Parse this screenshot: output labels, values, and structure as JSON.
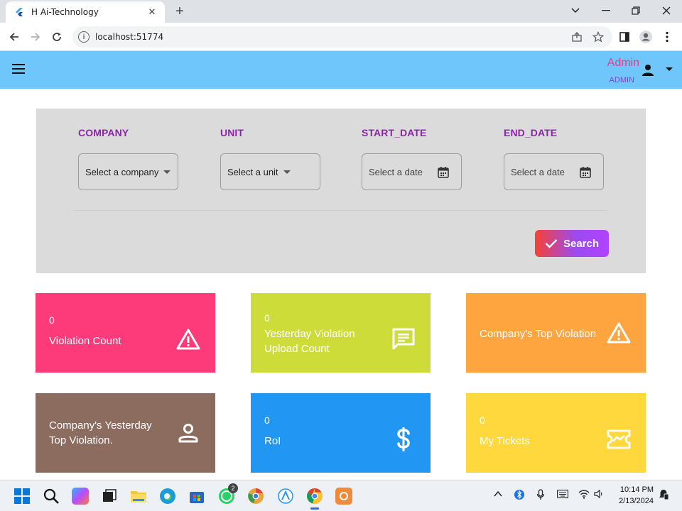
{
  "browser": {
    "tab_title": "H Ai-Technology",
    "tab_close": "✕",
    "new_tab": "+",
    "url": "localhost:51774"
  },
  "header": {
    "admin_name": "Admin",
    "admin_role": "ADMIN"
  },
  "filters": {
    "company_label": "COMPANY",
    "company_placeholder": "Select a company",
    "unit_label": "UNIT",
    "unit_placeholder": "Select a unit",
    "start_label": "START_DATE",
    "start_placeholder": "Select a date",
    "end_label": "END_DATE",
    "end_placeholder": "Select a date",
    "search_label": "Search"
  },
  "cards": [
    {
      "value": "0",
      "label": "Violation Count",
      "icon": "warning-icon",
      "color": "#fd3a7a"
    },
    {
      "value": "0",
      "label_line1": "Yesterday Violation",
      "label_line2": "Upload Count",
      "icon": "message-icon",
      "color": "#cddc39"
    },
    {
      "label": "Company's Top Violation",
      "icon": "warning-icon",
      "color": "#ffa53f"
    },
    {
      "label_line1": "Company's Yesterday",
      "label_line2": "Top Violation.",
      "icon": "person-outline-icon",
      "color": "#8c6c5f"
    },
    {
      "value": "0",
      "label": "RoI",
      "icon": "dollar-icon",
      "color": "#2196f3"
    },
    {
      "value": "0",
      "label": "My Tickets",
      "icon": "ticket-icon",
      "color": "#ffd83d"
    }
  ],
  "taskbar": {
    "time": "10:14 PM",
    "date": "2/13/2024",
    "whatsapp_badge": "2"
  }
}
